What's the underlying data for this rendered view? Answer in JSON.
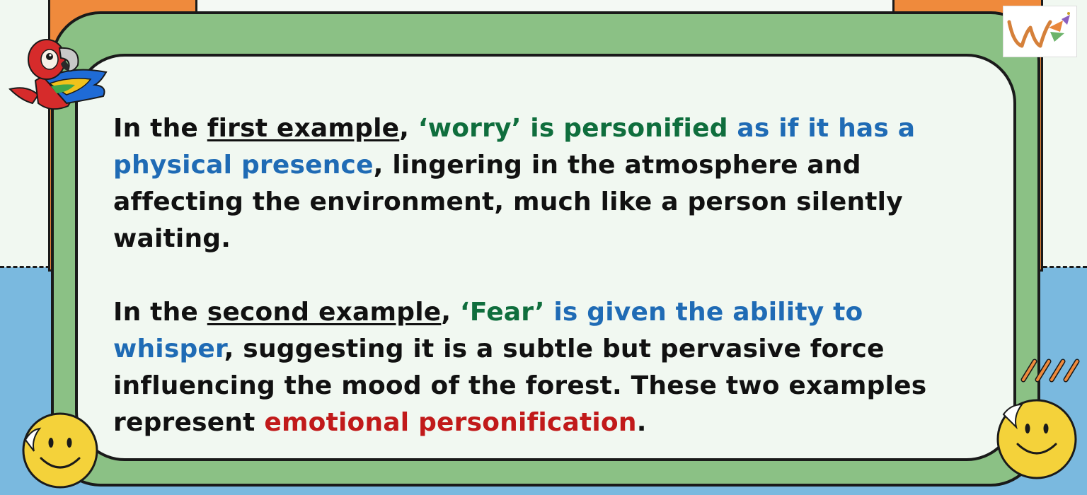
{
  "para1": {
    "t1": "In the ",
    "t2": "first example",
    "t3": ", ",
    "t4": "‘worry’ is personified",
    "t5": " as if it has a physical presence",
    "t6": ", lingering in the atmosphere and affecting the environment, much like a person silently waiting."
  },
  "para2": {
    "t1": "In the ",
    "t2": "second example",
    "t3": ", ",
    "t4": "‘Fear’",
    "t5": " is given the ability to whisper",
    "t6": ", suggesting it is a subtle but pervasive force influencing the mood of the forest. These two examples represent ",
    "t7": "emotional personification",
    "t8": "."
  },
  "colors": {
    "green_text": "#0f6e3d",
    "blue_text": "#1f6bb5",
    "red_text": "#c11a1a",
    "frame_green": "#8bc185",
    "orange": "#ef8a3c",
    "sky_blue": "#7ab9df"
  },
  "icons": [
    "parrot-icon",
    "smiley-icon",
    "logo-icon",
    "slash-decoration-icon"
  ]
}
